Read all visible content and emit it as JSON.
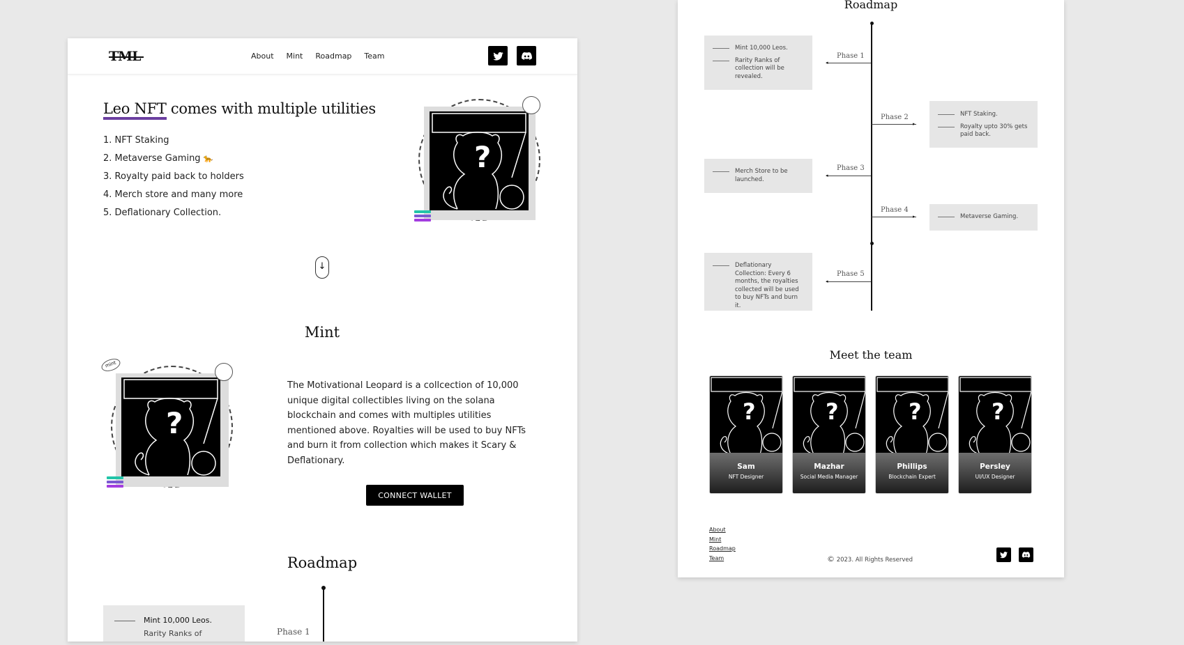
{
  "header": {
    "logo": "TML",
    "nav": [
      "About",
      "Mint",
      "Roadmap",
      "Team"
    ],
    "social": [
      "twitter-icon",
      "discord-icon"
    ]
  },
  "hero": {
    "title_highlight": "Leo NFT",
    "title_rest": " comes with multiple utilities",
    "utilities": [
      "1. NFT Staking",
      "2. Metaverse Gaming",
      "3. Royalty paid back to holders",
      "4. Merch store and many more",
      "5. Deflationary Collection."
    ],
    "scroll_icon": "↓"
  },
  "mint": {
    "title": "Mint",
    "description": "The Motivational Leopard is a collcection of 10,000 unique digital collectibles living on the solana blockchain and comes with multiples utilities mentioned above. Royalties will be used to buy NFTs and burn it from collection which makes it Scary & Deflationary.",
    "button": "CONNECT WALLET",
    "badge": "mint"
  },
  "roadmap": {
    "title": "Roadmap",
    "phases": [
      {
        "label": "Phase 1",
        "items": [
          "Mint 10,000 Leos.",
          "Rarity Ranks of collection will be revealed."
        ]
      },
      {
        "label": "Phase 2",
        "items": [
          "NFT Staking.",
          "Royalty upto 30% gets paid back."
        ]
      },
      {
        "label": "Phase 3",
        "items": [
          "Merch Store to be launched."
        ]
      },
      {
        "label": "Phase 4",
        "items": [
          "Metaverse Gaming."
        ]
      },
      {
        "label": "Phase 5",
        "items": [
          "Deflationary Collection: Every 6 months, the royalties collected will be used to buy NFTs and burn it."
        ]
      }
    ],
    "left_partial": {
      "item1": "Mint 10,000 Leos.",
      "item2": "Rarity Ranks of"
    }
  },
  "team": {
    "title": "Meet the team",
    "members": [
      {
        "name": "Sam",
        "role": "NFT Designer"
      },
      {
        "name": "Mazhar",
        "role": "Social Media Manager"
      },
      {
        "name": "Phillips",
        "role": "Blockchain Expert"
      },
      {
        "name": "Persley",
        "role": "UI/UX Designer"
      }
    ]
  },
  "footer": {
    "links": [
      "About",
      "Mint",
      "Roadmap",
      "Team"
    ],
    "copyright_symbol": "©",
    "copyright": "2023. All Rights Reserved"
  },
  "colors": {
    "accent": "#6b3fa0",
    "dark": "#000000",
    "box": "#e6e6e6"
  }
}
